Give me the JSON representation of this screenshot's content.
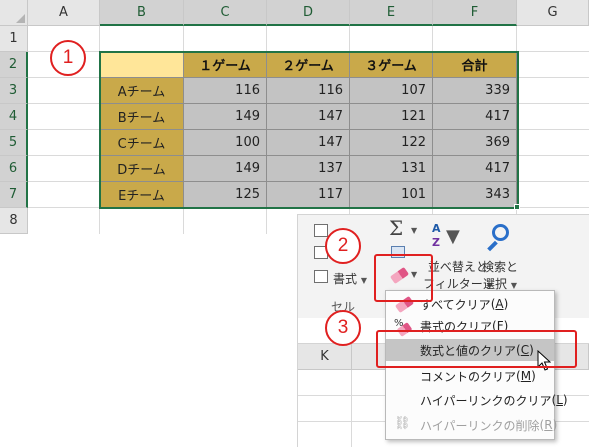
{
  "columns": [
    "A",
    "B",
    "C",
    "D",
    "E",
    "F",
    "G"
  ],
  "rows": [
    "1",
    "2",
    "3",
    "4",
    "5",
    "6",
    "7",
    "8"
  ],
  "lower_column_label": "K",
  "table": {
    "headers": [
      "",
      "１ゲーム",
      "２ゲーム",
      "３ゲーム",
      "合計"
    ],
    "rows": [
      {
        "team": "Aチーム",
        "values": [
          "116",
          "116",
          "107",
          "339"
        ]
      },
      {
        "team": "Bチーム",
        "values": [
          "149",
          "147",
          "121",
          "417"
        ]
      },
      {
        "team": "Cチーム",
        "values": [
          "100",
          "147",
          "122",
          "369"
        ]
      },
      {
        "team": "Dチーム",
        "values": [
          "149",
          "137",
          "131",
          "417"
        ]
      },
      {
        "team": "Eチーム",
        "values": [
          "125",
          "117",
          "101",
          "343"
        ]
      }
    ]
  },
  "annotations": {
    "step1": "1",
    "step2": "2",
    "step3": "3",
    "accent_color": "#e02020"
  },
  "ribbon": {
    "format_label": "書式",
    "group_label": "セル",
    "sort_filter_line1": "並べ替えと",
    "sort_filter_line2": "フィルター",
    "find_select_line1": "検索と",
    "find_select_line2": "選択"
  },
  "menu": {
    "items": [
      {
        "label": "すべてクリア",
        "key": "A",
        "icon": "eraser-icon",
        "enabled": true
      },
      {
        "label": "書式のクリア",
        "key": "F",
        "icon": "clear-format-icon",
        "enabled": true
      },
      {
        "label": "数式と値のクリア",
        "key": "C",
        "icon": "",
        "enabled": true,
        "highlighted": true
      },
      {
        "label": "コメントのクリア",
        "key": "M",
        "icon": "",
        "enabled": true
      },
      {
        "label": "ハイパーリンクのクリア",
        "key": "L",
        "icon": "",
        "enabled": true
      },
      {
        "label": "ハイパーリンクの削除",
        "key": "R",
        "icon": "remove-link-icon",
        "enabled": false
      }
    ]
  },
  "colors": {
    "header_gold": "#c9a94a",
    "blank_yellow": "#ffe699",
    "value_gray": "#c3c3c3",
    "selection_green": "#217346"
  }
}
